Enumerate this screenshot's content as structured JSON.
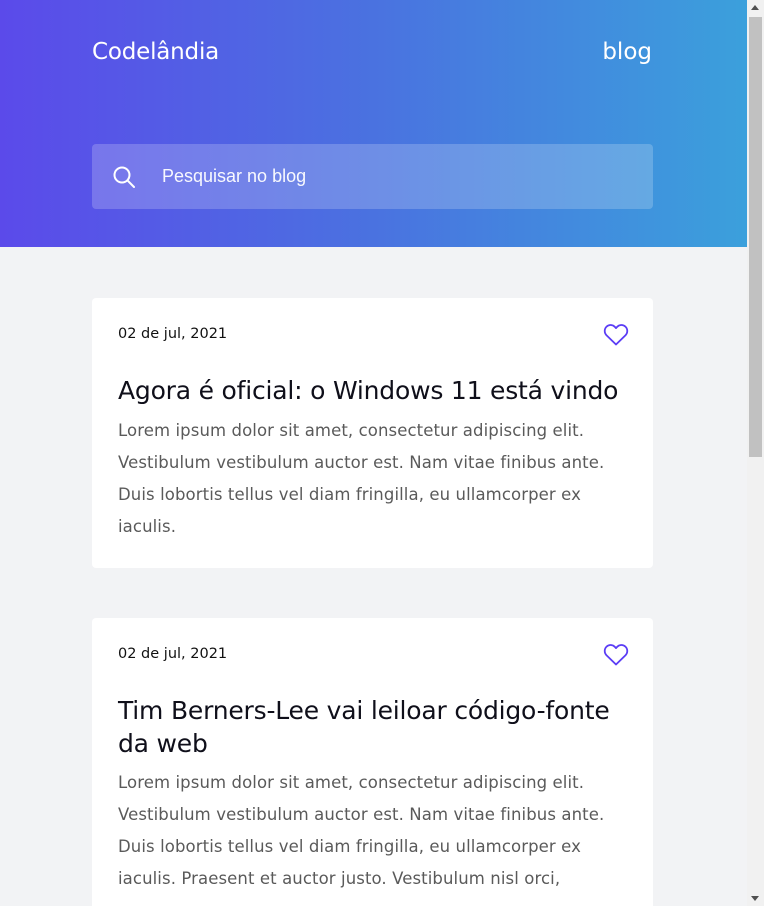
{
  "header": {
    "brand": "Codelândia",
    "nav_link": "blog",
    "gradient_colors": [
      "#5b4aea",
      "#4a72e0",
      "#3ba0dc"
    ]
  },
  "search": {
    "icon": "search-icon",
    "placeholder": "Pesquisar no blog",
    "value": ""
  },
  "posts": [
    {
      "date": "02 de jul, 2021",
      "title": "Agora é oficial: o Windows 11 está vindo",
      "excerpt": "Lorem ipsum dolor sit amet, consectetur adipiscing elit. Vestibulum vestibulum auctor est. Nam vitae finibus ante. Duis lobortis tellus vel diam fringilla, eu ullamcorper ex iaculis.",
      "like_icon": "heart-outline-icon"
    },
    {
      "date": "02 de jul, 2021",
      "title": "Tim Berners-Lee vai leiloar código-fonte da web",
      "excerpt": "Lorem ipsum dolor sit amet, consectetur adipiscing elit. Vestibulum vestibulum auctor est. Nam vitae finibus ante. Duis lobortis tellus vel diam fringilla, eu ullamcorper ex iaculis. Praesent et auctor justo. Vestibulum nisl orci,",
      "like_icon": "heart-outline-icon"
    }
  ],
  "colors": {
    "accent": "#5b3df5",
    "page_background": "#f2f3f5",
    "card_background": "#ffffff"
  }
}
